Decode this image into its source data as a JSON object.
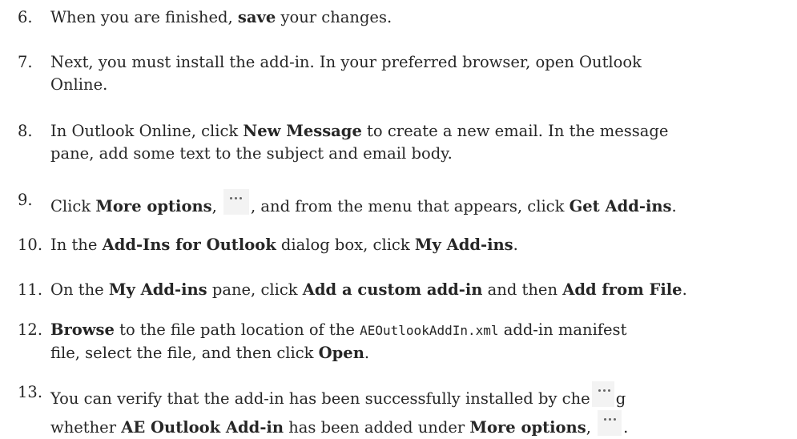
{
  "steps": [
    {
      "num": "6.",
      "parts": [
        "When you are finished, ",
        "save",
        " your changes."
      ]
    },
    {
      "num": "7.",
      "line1": "Next, you must install the add-in. In your preferred browser, open Outlook",
      "line2": "Online."
    },
    {
      "num": "8.",
      "line1_a": "In Outlook Online, click ",
      "line1_b": "New Message",
      "line1_c": " to create a new email. In the message",
      "line2": "pane, add some text to the subject and email body."
    },
    {
      "num": "9.",
      "a": "Click ",
      "b": "More options",
      "c": ", ",
      "d": ", and from the menu that appears, click ",
      "e": "Get Add-ins",
      "f": "."
    },
    {
      "num": "10.",
      "a": "In the ",
      "b": "Add-Ins for Outlook",
      "c": " dialog box, click ",
      "d": "My Add-ins",
      "e": "."
    },
    {
      "num": "11.",
      "a": "On the ",
      "b": "My Add-ins",
      "c": " pane, click ",
      "d": "Add a custom add-in",
      "e": " and then ",
      "f": "Add from File",
      "g": "."
    },
    {
      "num": "12.",
      "a": "Browse",
      "b": " to the file path location of the ",
      "c": "AEOutlookAddIn.xml",
      "d": " add-in manifest",
      "e": "file, select the file, and then click ",
      "f": "Open",
      "g": "."
    },
    {
      "num": "13.",
      "a": "You can verify that the add-in has been successfully installed by che",
      "b": "g",
      "c": "whether ",
      "d": "AE Outlook Add-in",
      "e": " has been added under ",
      "f": "More options",
      "g": ",",
      "h": "."
    }
  ],
  "icons": {
    "more_options": "more-options-icon"
  }
}
